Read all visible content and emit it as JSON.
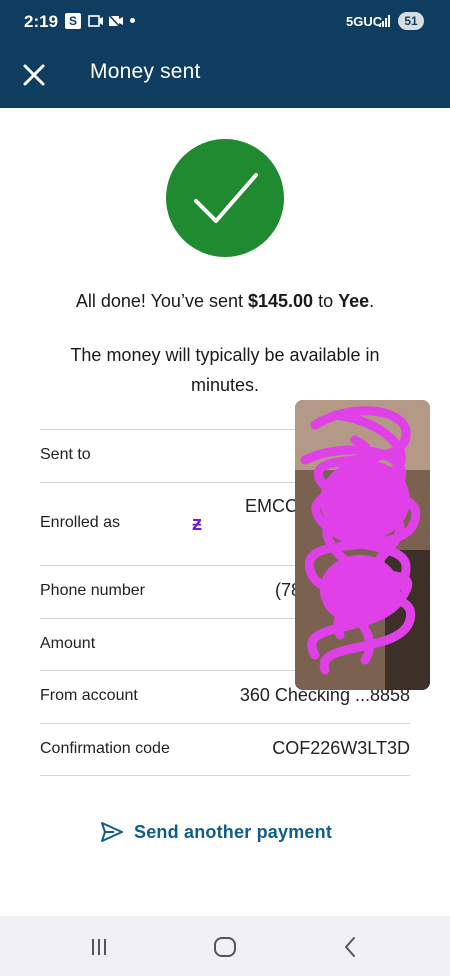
{
  "status_bar": {
    "time": "2:19",
    "s_badge": "S",
    "network": "5GUC",
    "battery": "51"
  },
  "header": {
    "title": "Money sent",
    "close_icon": "close-icon"
  },
  "confirmation": {
    "icon": "checkmark-icon",
    "line_prefix": "All done! You’ve sent ",
    "amount": "$145.00",
    "line_mid": " to ",
    "recipient": "Yee",
    "line_suffix": ".",
    "sub_message": "The money will typically be available in minutes."
  },
  "details": {
    "rows": [
      {
        "label": "Sent to",
        "value": ""
      },
      {
        "label": "Enrolled as",
        "value": "EMCC"
      },
      {
        "label": "Phone number",
        "value": "(78"
      },
      {
        "label": "Amount",
        "value": ""
      },
      {
        "label": "From account",
        "value": "360 Checking ...8858"
      },
      {
        "label": "Confirmation code",
        "value": "COF226W3LT3D"
      }
    ]
  },
  "actions": {
    "send_another": "Send another payment"
  },
  "colors": {
    "header_bg": "#0f3d5f",
    "success_green": "#1f8a2f",
    "link_blue": "#0f5d8a",
    "zelle_purple": "#6d1ed4",
    "redaction_magenta": "#e040e8"
  }
}
